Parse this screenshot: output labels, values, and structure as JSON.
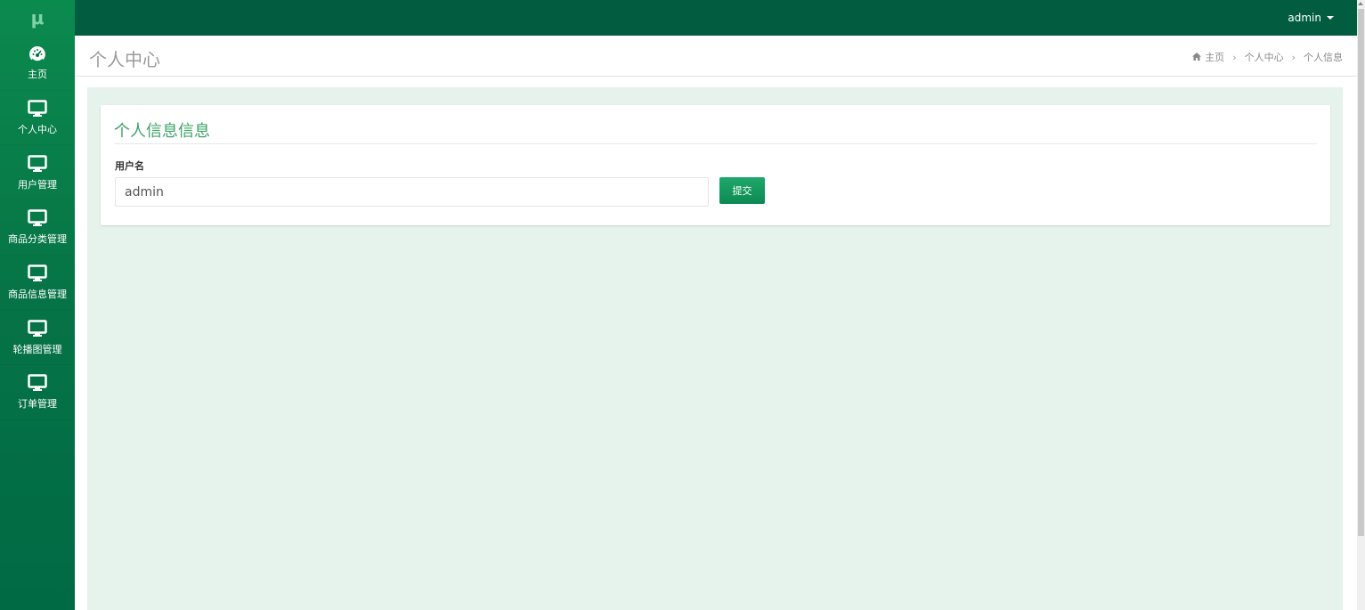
{
  "app": {
    "logo": "μ"
  },
  "topbar": {
    "user_label": "admin"
  },
  "sidebar": {
    "items": [
      {
        "label": "主页",
        "icon": "dashboard-icon"
      },
      {
        "label": "个人中心",
        "icon": "monitor-icon"
      },
      {
        "label": "用户管理",
        "icon": "monitor-icon"
      },
      {
        "label": "商品分类管理",
        "icon": "monitor-icon"
      },
      {
        "label": "商品信息管理",
        "icon": "monitor-icon"
      },
      {
        "label": "轮播图管理",
        "icon": "monitor-icon"
      },
      {
        "label": "订单管理",
        "icon": "monitor-icon"
      }
    ]
  },
  "header": {
    "title": "个人中心",
    "breadcrumb": [
      "主页",
      "个人中心",
      "个人信息"
    ],
    "breadcrumb_icon": "home-icon"
  },
  "form": {
    "title": "个人信息信息",
    "username_label": "用户名",
    "username_value": "admin",
    "submit_label": "提交"
  },
  "colors": {
    "sidebar": "#067346",
    "topbar": "#025c3f",
    "accent": "#3fa36a",
    "content_bg": "#e6f2ec"
  }
}
